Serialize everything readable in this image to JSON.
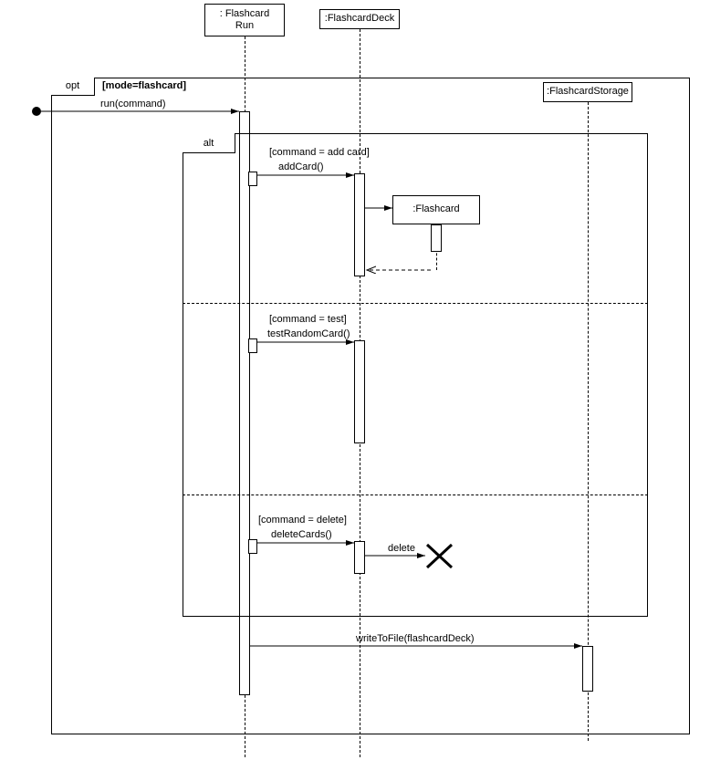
{
  "participants": {
    "flashcardRun": ": Flashcard\nRun",
    "flashcardDeck": ":FlashcardDeck",
    "flashcardStorage": ":FlashcardStorage",
    "flashcard": ":Flashcard"
  },
  "optFrame": {
    "label": "opt",
    "guard": "[mode=flashcard]"
  },
  "altFrame": {
    "label": "alt",
    "guards": {
      "add": "[command = add card]",
      "test": "[command = test]",
      "delete": "[command = delete]"
    }
  },
  "messages": {
    "run": "run(command)",
    "addCard": "addCard()",
    "testRandomCard": "testRandomCard()",
    "deleteCards": "deleteCards()",
    "delete": "delete",
    "writeToFile": "writeToFile(flashcardDeck)"
  }
}
